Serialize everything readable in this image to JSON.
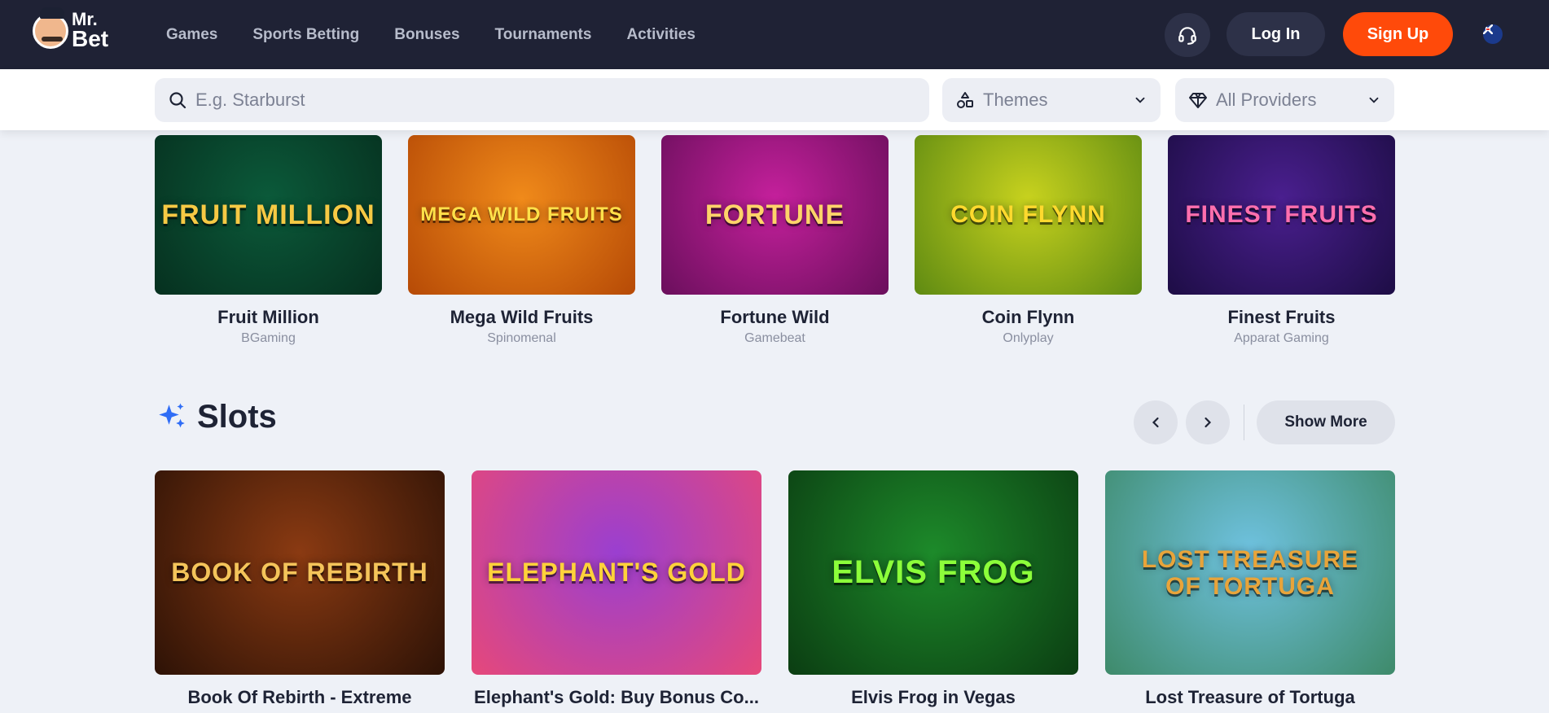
{
  "header": {
    "logo": {
      "line1": "Mr.",
      "line2": "Bet"
    },
    "nav": [
      "Games",
      "Sports Betting",
      "Bonuses",
      "Tournaments",
      "Activities"
    ],
    "login_label": "Log In",
    "signup_label": "Sign Up"
  },
  "filters": {
    "search_placeholder": "E.g. Starburst",
    "themes_label": "Themes",
    "providers_label": "All Providers"
  },
  "featured_games": [
    {
      "name": "Fruit Million",
      "provider": "BGaming",
      "art": "FRUIT MILLION",
      "bg1": "#0b5a3a",
      "bg2": "#06301f",
      "fg": "#f6c944"
    },
    {
      "name": "Mega Wild Fruits",
      "provider": "Spinomenal",
      "art": "MEGA WILD FRUITS",
      "bg1": "#f08a1a",
      "bg2": "#b64a06",
      "fg": "#ffe14a"
    },
    {
      "name": "Fortune Wild",
      "provider": "Gamebeat",
      "art": "FORTUNE",
      "bg1": "#c5209c",
      "bg2": "#6a0f5c",
      "fg": "#ffd36a"
    },
    {
      "name": "Coin Flynn",
      "provider": "Onlyplay",
      "art": "COIN FLYNN",
      "bg1": "#c8d21e",
      "bg2": "#5e8a12",
      "fg": "#ffd92e"
    },
    {
      "name": "Finest Fruits",
      "provider": "Apparat Gaming",
      "art": "FINEST FRUITS",
      "bg1": "#4a1f8f",
      "bg2": "#1d0d45",
      "fg": "#ff6fae"
    }
  ],
  "slots": {
    "title": "Slots",
    "show_more_label": "Show More",
    "games": [
      {
        "name": "Book Of Rebirth - Extreme",
        "art": "BOOK OF REBIRTH",
        "bg1": "#8a3a12",
        "bg2": "#2d1206",
        "fg": "#f4c45a"
      },
      {
        "name": "Elephant's Gold: Buy Bonus Co...",
        "art": "ELEPHANT'S GOLD",
        "bg1": "#9a3fd0",
        "bg2": "#e6487a",
        "fg": "#ffd23a"
      },
      {
        "name": "Elvis Frog in Vegas",
        "art": "ELVIS FROG",
        "bg1": "#1d8a2a",
        "bg2": "#0b3d12",
        "fg": "#8cff3a"
      },
      {
        "name": "Lost Treasure of Tortuga",
        "art": "LOST TREASURE OF TORTUGA",
        "bg1": "#6fc2e0",
        "bg2": "#3e8a6a",
        "fg": "#e8a43a"
      }
    ]
  }
}
